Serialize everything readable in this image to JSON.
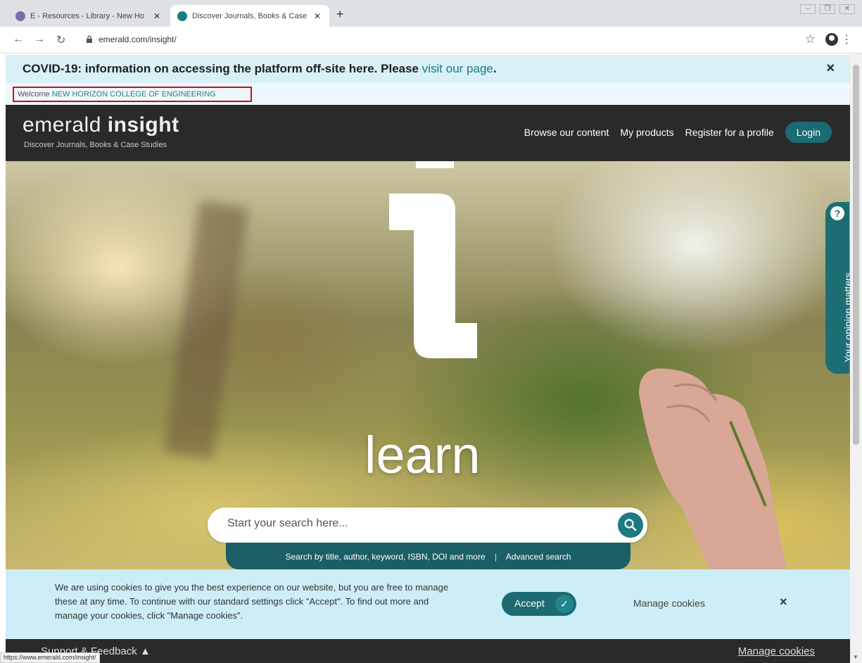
{
  "browser": {
    "tabs": [
      {
        "title": "E - Resources - Library - New Ho",
        "active": false
      },
      {
        "title": "Discover Journals, Books & Case",
        "active": true
      }
    ],
    "new_tab": "+",
    "url": "emerald.com/insight/",
    "status_url": "https://www.emerald.com/insight/"
  },
  "covid_banner": {
    "text": "COVID-19: information on accessing the platform off-site here. Please",
    "link_text": "visit our page",
    "period": ".",
    "close": "×"
  },
  "welcome": {
    "prefix": "Welcome",
    "institution": "NEW HORIZON COLLEGE OF ENGINEERING"
  },
  "header": {
    "logo_light": "emerald",
    "logo_bold": "insight",
    "tagline": "Discover Journals, Books & Case Studies",
    "nav": [
      "Browse our content",
      "My products",
      "Register for a profile"
    ],
    "login": "Login"
  },
  "hero": {
    "big_letter": "l",
    "word": "learn",
    "search_placeholder": "Start your search here...",
    "search_hint": "Search by title, author, keyword, ISBN, DOI and more",
    "hint_separator": "|",
    "advanced_search": "Advanced search",
    "feedback_tab": "Your opinion matters",
    "feedback_icon": "?"
  },
  "cookie_banner": {
    "text": "We are using cookies to give you the best experience on our website, but you are free to manage these at any time. To continue with our standard settings click \"Accept\". To find out more and manage your cookies, click \"Manage cookies\".",
    "accept": "Accept",
    "manage": "Manage cookies",
    "close": "×"
  },
  "footer": {
    "support": "Support & Feedback",
    "manage": "Manage cookies"
  },
  "colors": {
    "brand_teal": "#1c6a72",
    "header_dark": "#2a2a2b",
    "banner_light_blue": "#d9f0f7",
    "highlight_red": "#c0111a"
  },
  "icons": [
    "back-arrow-icon",
    "forward-arrow-icon",
    "reload-icon",
    "lock-icon",
    "bookmark-star-icon",
    "profile-icon",
    "menu-kebab-icon",
    "search-icon",
    "check-icon",
    "close-icon",
    "caret-up-icon"
  ]
}
